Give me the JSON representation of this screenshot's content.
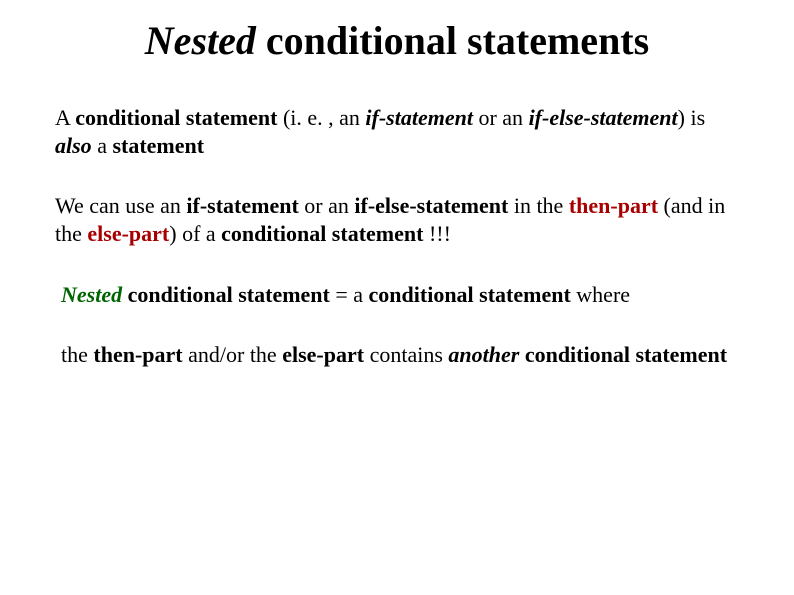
{
  "title": {
    "part1": "Nested",
    "part2": " conditional statements"
  },
  "p1": {
    "t1": "A ",
    "t2": "conditional statement",
    "t3": " (i. e. , an ",
    "t4": "if-statement",
    "t5": " or an ",
    "t6": "if-else-statement",
    "t7": ") is ",
    "t8": "also",
    "t9": " a ",
    "t10": "statement"
  },
  "p2": {
    "t1": "We can use an ",
    "t2": "if-statement",
    "t3": " or an ",
    "t4": "if-else-statement",
    "t5": " in the ",
    "t6": "then-part",
    "t7": " (and in the ",
    "t8": "else-part",
    "t9": ") of a ",
    "t10": "conditional statement",
    "t11": " !!!"
  },
  "p3": {
    "t1": "Nested",
    "t2": " conditional statement",
    "t3": " = a ",
    "t4": "conditional statement",
    "t5": " where"
  },
  "p4": {
    "t1": " the ",
    "t2": "then-part",
    "t3": " and/or the ",
    "t4": "else-part",
    "t5": " contains ",
    "t6": "another",
    "t7": " conditional statement"
  }
}
